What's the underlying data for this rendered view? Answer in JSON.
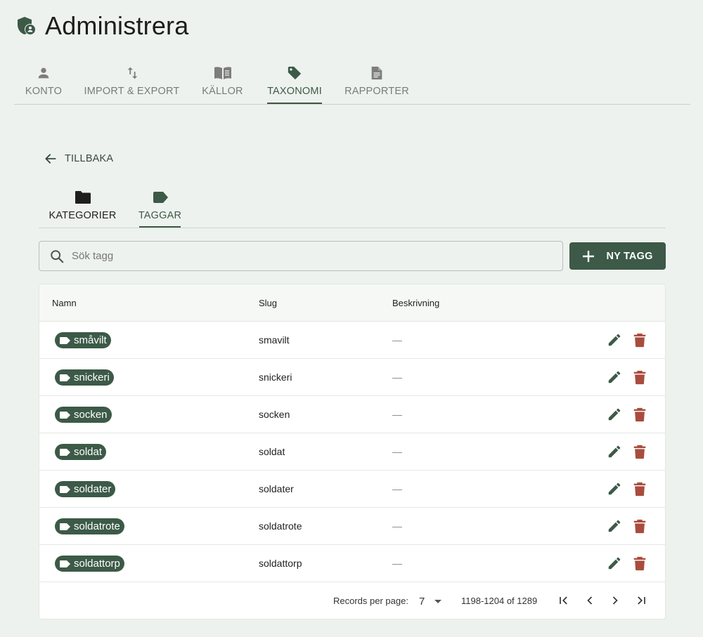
{
  "app": {
    "title": "Administrera"
  },
  "main_tabs": [
    {
      "label": "KONTO",
      "icon": "person-icon"
    },
    {
      "label": "IMPORT & EXPORT",
      "icon": "swap-vert-icon"
    },
    {
      "label": "KÄLLOR",
      "icon": "book-icon"
    },
    {
      "label": "TAXONOMI",
      "icon": "tag-icon",
      "active": true
    },
    {
      "label": "RAPPORTER",
      "icon": "document-icon"
    }
  ],
  "back": {
    "label": "TILLBAKA"
  },
  "sub_tabs": [
    {
      "label": "KATEGORIER",
      "icon": "folder-icon"
    },
    {
      "label": "TAGGAR",
      "icon": "tag-icon",
      "active": true
    }
  ],
  "search": {
    "placeholder": "Sök tagg",
    "value": ""
  },
  "new_button": {
    "label": "NY TAGG"
  },
  "table": {
    "columns": {
      "name": "Namn",
      "slug": "Slug",
      "description": "Beskrivning"
    },
    "rows": [
      {
        "name": "småvilt",
        "slug": "smavilt",
        "description": "—"
      },
      {
        "name": "snickeri",
        "slug": "snickeri",
        "description": "—"
      },
      {
        "name": "socken",
        "slug": "socken",
        "description": "—"
      },
      {
        "name": "soldat",
        "slug": "soldat",
        "description": "—"
      },
      {
        "name": "soldater",
        "slug": "soldater",
        "description": "—"
      },
      {
        "name": "soldatrote",
        "slug": "soldatrote",
        "description": "—"
      },
      {
        "name": "soldattorp",
        "slug": "soldattorp",
        "description": "—"
      }
    ]
  },
  "pagination": {
    "rows_per_page_label": "Records per page:",
    "rows_per_page": "7",
    "range": "1198-1204 of 1289"
  },
  "colors": {
    "accent": "#3c5a47",
    "delete": "#a94c3e",
    "background": "#eef2ee"
  }
}
